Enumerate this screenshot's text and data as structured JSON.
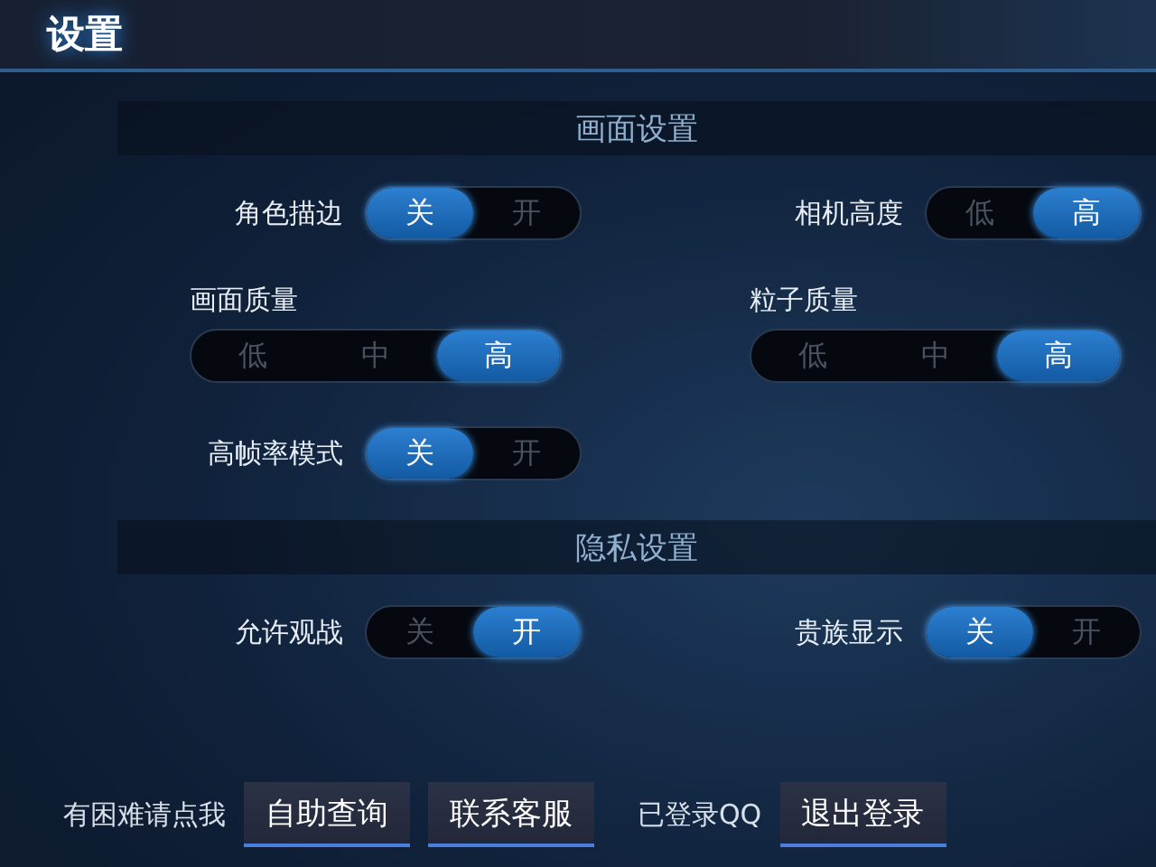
{
  "window": {
    "title": "设置"
  },
  "sections": [
    {
      "title": "画面设置",
      "rows": [
        [
          {
            "kind": "inline",
            "label": "角色描边",
            "options": [
              {
                "label": "关",
                "selected": true
              },
              {
                "label": "开",
                "selected": false
              }
            ]
          },
          {
            "kind": "inline",
            "label": "相机高度",
            "options": [
              {
                "label": "低",
                "selected": false
              },
              {
                "label": "高",
                "selected": true
              }
            ]
          }
        ],
        [
          {
            "kind": "stacked",
            "label": "画面质量",
            "options": [
              {
                "label": "低",
                "selected": false
              },
              {
                "label": "中",
                "selected": false
              },
              {
                "label": "高",
                "selected": true
              }
            ]
          },
          {
            "kind": "stacked",
            "label": "粒子质量",
            "options": [
              {
                "label": "低",
                "selected": false
              },
              {
                "label": "中",
                "selected": false
              },
              {
                "label": "高",
                "selected": true
              }
            ]
          }
        ],
        [
          {
            "kind": "inline",
            "label": "高帧率模式",
            "options": [
              {
                "label": "关",
                "selected": true
              },
              {
                "label": "开",
                "selected": false
              }
            ]
          }
        ]
      ]
    },
    {
      "title": "隐私设置",
      "rows": [
        [
          {
            "kind": "inline",
            "label": "允许观战",
            "options": [
              {
                "label": "关",
                "selected": false
              },
              {
                "label": "开",
                "selected": true
              }
            ]
          },
          {
            "kind": "inline",
            "label": "贵族显示",
            "options": [
              {
                "label": "关",
                "selected": true
              },
              {
                "label": "开",
                "selected": false
              }
            ]
          }
        ]
      ]
    }
  ],
  "footer": {
    "help_text": "有困难请点我",
    "buttons": [
      "自助查询",
      "联系客服"
    ],
    "login_status": "已登录QQ",
    "logout_button": "退出登录"
  }
}
